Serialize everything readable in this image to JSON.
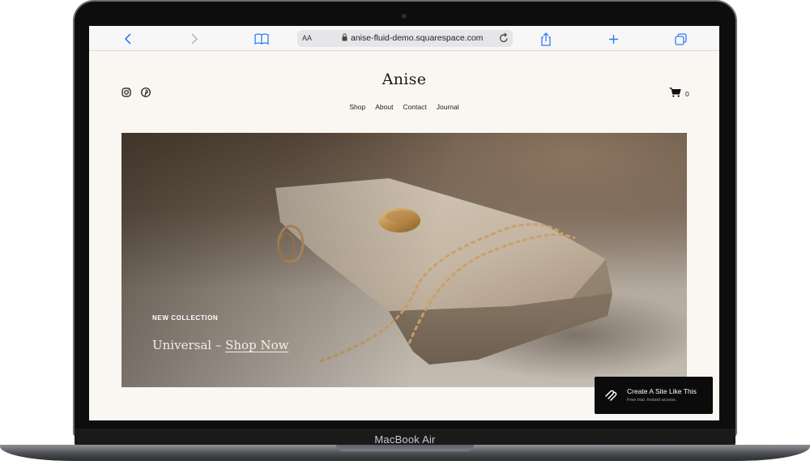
{
  "device": {
    "model_label": "MacBook Air"
  },
  "browser": {
    "text_size_label": "AA",
    "url": "anise-fluid-demo.squarespace.com"
  },
  "site": {
    "title": "Anise",
    "nav": [
      "Shop",
      "About",
      "Contact",
      "Journal"
    ],
    "cart_count": "0",
    "social_icons": [
      "instagram-icon",
      "pinterest-icon"
    ]
  },
  "hero": {
    "eyebrow": "NEW COLLECTION",
    "headline_prefix": "Universal – ",
    "headline_link": "Shop Now"
  },
  "badge": {
    "title": "Create A Site Like This",
    "subtitle": "Free trial. Instant access."
  },
  "colors": {
    "toolbar_accent": "#2f7bf5",
    "page_background": "#faf7f2",
    "badge_background": "#0b0b0b"
  }
}
